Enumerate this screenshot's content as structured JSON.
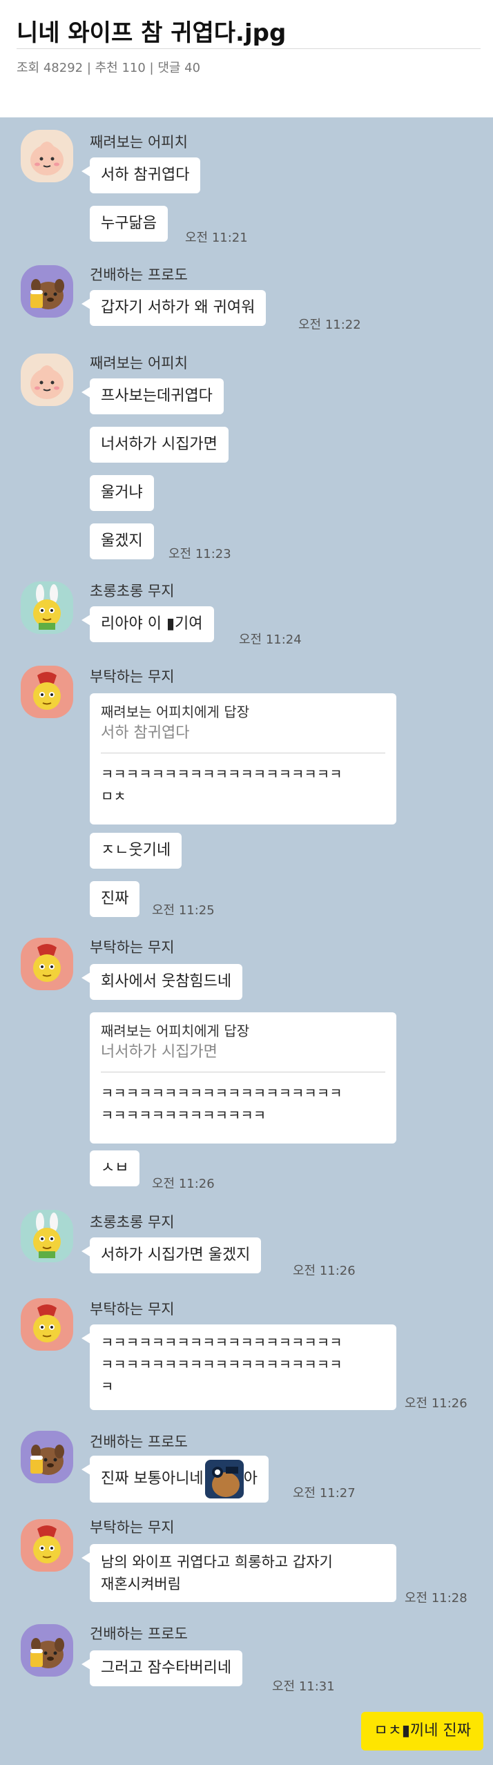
{
  "post": {
    "title": "니네 와이프 참 귀엽다.jpg",
    "meta": "조회 48292 | 추천 110 | 댓글 40"
  },
  "chat": {
    "ampm": "오전",
    "m1": {
      "name": "째려보는 어피치",
      "b1": "서하 참귀엽다",
      "b2": "누구닮음",
      "time": "오전 11:21"
    },
    "m2": {
      "name": "건배하는 프로도",
      "b1": "갑자기 서하가 왜 귀여워",
      "time": "오전 11:22"
    },
    "m3": {
      "name": "째려보는 어피치",
      "b1": "프사보는데귀엽다",
      "b2": "너서하가 시집가면",
      "b3": "울거냐",
      "b4": "울겠지",
      "time": "오전 11:23"
    },
    "m4": {
      "name": "초롱초롱 무지",
      "b1": "리아야 이 ▮기여",
      "time": "오전 11:24"
    },
    "m5": {
      "name": "부탁하는 무지",
      "reply": {
        "head": "째려보는 어피치에게 답장",
        "quote": "서하 참귀엽다",
        "body": "ㅋㅋㅋㅋㅋㅋㅋㅋㅋㅋㅋㅋㅋㅋㅋㅋㅋㅋㅋ\nㅁㅊ"
      },
      "b2": "ㅈㄴ웃기네",
      "b3": "진짜",
      "time": "오전 11:25"
    },
    "m6": {
      "name": "부탁하는 무지",
      "b1": "회사에서 웃참힘드네",
      "reply": {
        "head": "째려보는 어피치에게 답장",
        "quote": "너서하가 시집가면",
        "body": "ㅋㅋㅋㅋㅋㅋㅋㅋㅋㅋㅋㅋㅋㅋㅋㅋㅋㅋㅋ\nㅋㅋㅋㅋㅋㅋㅋㅋㅋㅋㅋㅋㅋ"
      },
      "b3": "ㅅㅂ",
      "time": "오전 11:26"
    },
    "m7": {
      "name": "초롱초롱 무지",
      "b1": "서하가 시집가면 울겠지",
      "time": "오전 11:26"
    },
    "m8": {
      "name": "부탁하는 무지",
      "b1": "ㅋㅋㅋㅋㅋㅋㅋㅋㅋㅋㅋㅋㅋㅋㅋㅋㅋㅋㅋ\nㅋㅋㅋㅋㅋㅋㅋㅋㅋㅋㅋㅋㅋㅋㅋㅋㅋㅋㅋ\nㅋ",
      "time": "오전 11:26"
    },
    "m9": {
      "name": "건배하는 프로도",
      "b1a": "진짜 보통아니네",
      "b1b": "아",
      "time": "오전 11:27"
    },
    "m10": {
      "name": "부탁하는 무지",
      "b1": "남의 와이프 귀엽다고 희롱하고 갑자기\n재혼시켜버림",
      "time": "오전 11:28"
    },
    "m11": {
      "name": "건배하는 프로도",
      "b1": "그러고 잠수타버리네",
      "time": "오전 11:31"
    },
    "mine": {
      "b1": "ㅁㅊ▮끼네 진짜"
    }
  },
  "colors": {
    "chat_bg": "#b9cad9",
    "my_bubble": "#fee500",
    "bubble": "#ffffff"
  }
}
